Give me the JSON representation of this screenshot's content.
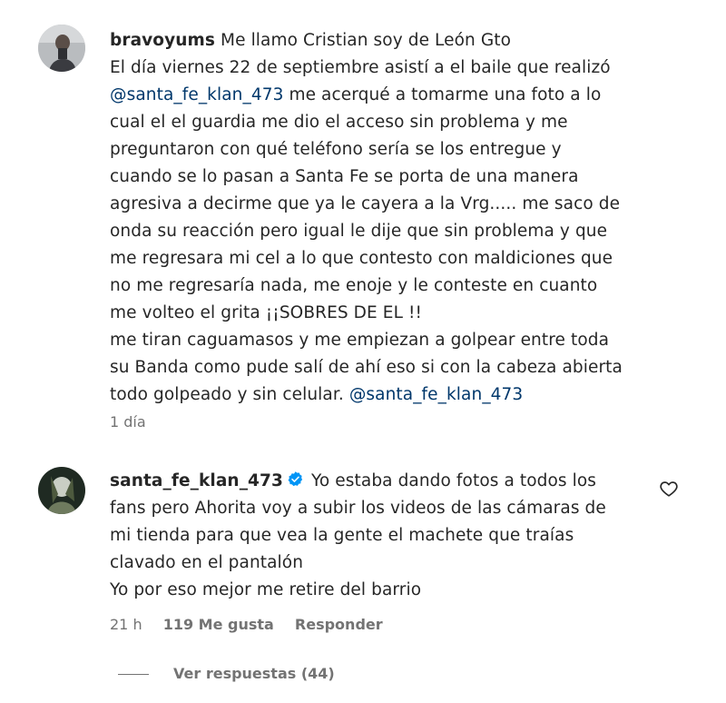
{
  "comment1": {
    "username": "bravoyums",
    "lines": [
      "Me llamo Cristian soy de León Gto",
      "El día viernes 22 de septiembre asistí a el baile que realizó",
      "me acerqué a tomarme una foto a lo",
      "cual el el guardia me dio el acceso sin problema y me",
      "preguntaron con qué teléfono sería se los entregue y",
      "cuando se lo pasan a Santa Fe se porta de una manera",
      "agresiva a decirme que ya le cayera a la Vrg..... me saco de",
      "onda su reacción pero igual le dije que sin problema y que",
      "me regresara mi cel a lo que contesto con maldiciones que",
      "no me regresaría nada, me enoje y le conteste en cuanto",
      "me volteo el grita ¡¡SOBRES DE EL !!",
      "me tiran caguamasos y me empiezan a golpear entre toda",
      "su Banda como pude salí de ahí eso si con la cabeza abierta",
      "todo golpeado y sin celular."
    ],
    "mention": "@santa_fe_klan_473",
    "time": "1 día"
  },
  "comment2": {
    "username": "santa_fe_klan_473",
    "lines": [
      "Yo estaba dando fotos a todos los",
      "fans pero Ahorita voy a subir los videos de las cámaras de",
      "mi tienda para que vea la gente el machete que traías",
      "clavado en el pantalón",
      "Yo por eso mejor me retire del barrio"
    ],
    "time": "21 h",
    "likes": "119 Me gusta",
    "reply_label": "Responder",
    "view_replies": "Ver respuestas (44)"
  },
  "icons": {
    "verified": "verified-badge-icon",
    "like": "heart-outline-icon"
  },
  "colors": {
    "mention": "#00376b",
    "verified": "#0095f6",
    "meta": "#737373",
    "text": "#262626"
  }
}
